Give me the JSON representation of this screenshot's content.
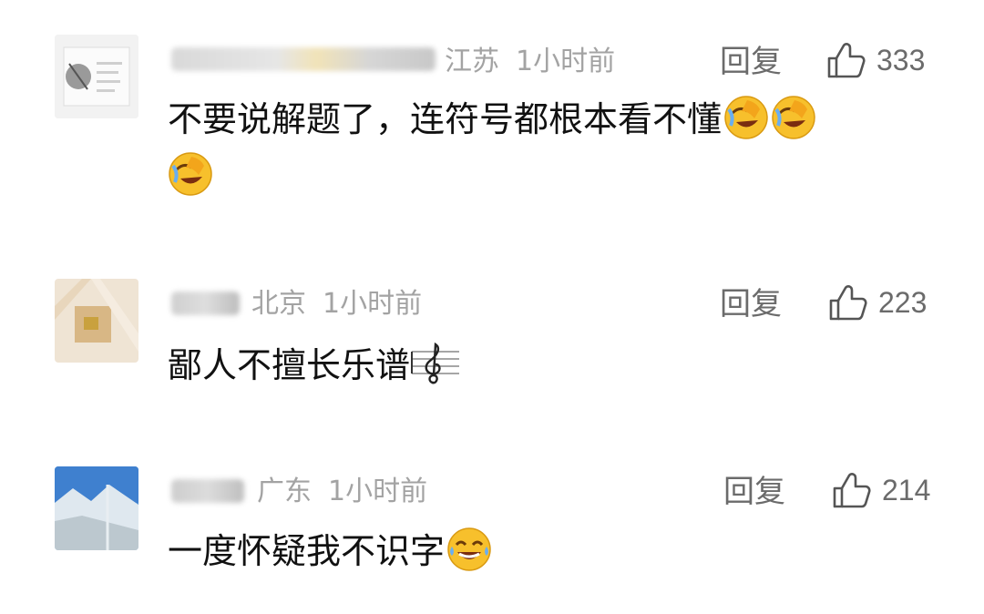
{
  "comments": [
    {
      "location": "江苏",
      "time": "1小时前",
      "reply_label": "回复",
      "likes": "333",
      "text": "不要说解题了，连符号都根本看不懂",
      "emojis": [
        "rolling-laugh-emoji",
        "rolling-laugh-emoji",
        "rolling-laugh-emoji"
      ]
    },
    {
      "location": "北京",
      "time": "1小时前",
      "reply_label": "回复",
      "likes": "223",
      "text": "鄙人不擅长乐谱",
      "emojis": [
        "music-score-emoji"
      ]
    },
    {
      "location": "广东",
      "time": "1小时前",
      "reply_label": "回复",
      "likes": "214",
      "text": "一度怀疑我不识字",
      "emojis": [
        "tears-of-joy-emoji"
      ]
    }
  ],
  "colors": {
    "meta_text": "#a3a3a3",
    "action_text": "#6b6b6b",
    "body_text": "#111111",
    "emoji_face": "#f7c02c"
  }
}
